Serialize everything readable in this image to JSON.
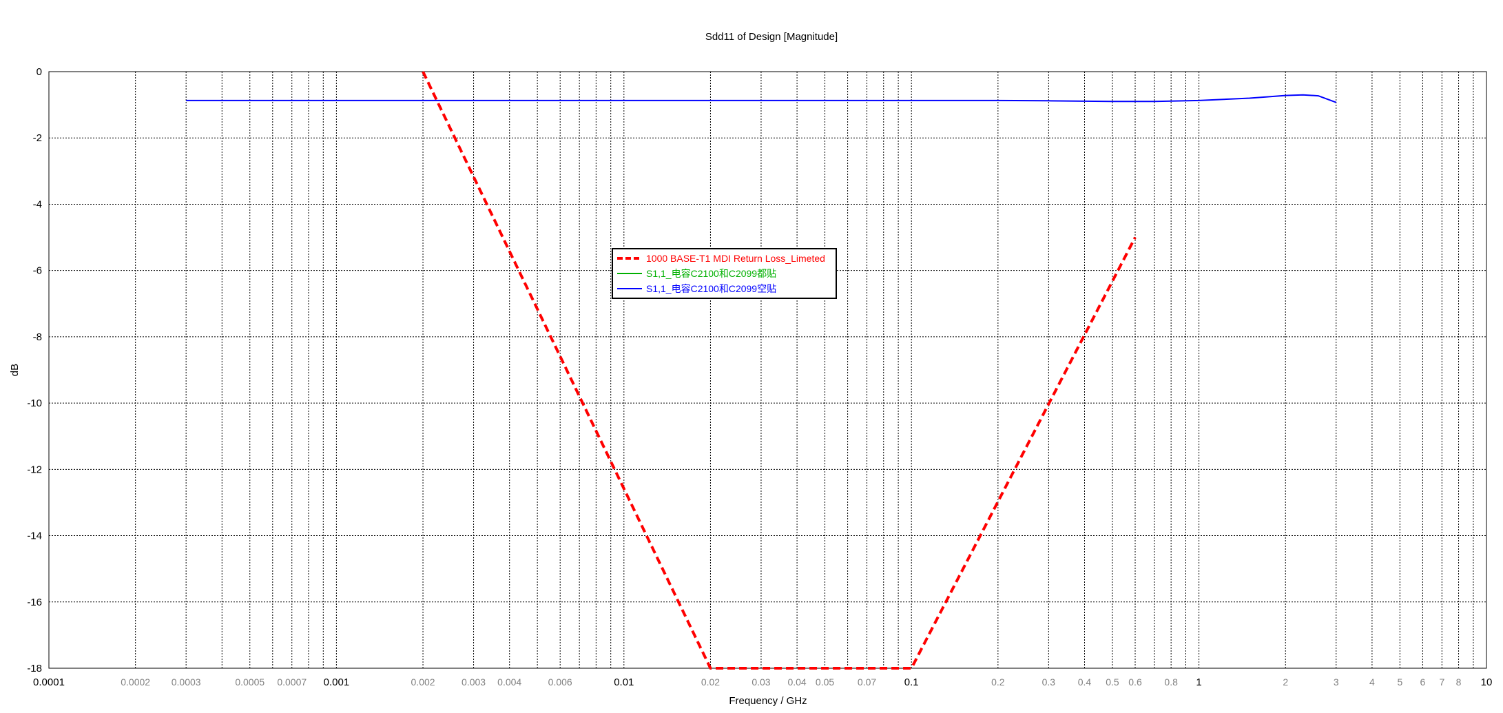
{
  "chart_data": {
    "type": "line",
    "title": "Sdd11 of Design [Magnitude]",
    "xlabel": "Frequency / GHz",
    "ylabel": "dB",
    "x_scale": "log",
    "xlim": [
      0.0001,
      10
    ],
    "ylim": [
      -18,
      0
    ],
    "grid": true,
    "legend_placement": "center",
    "x_ticks": [
      {
        "value": 0.0001,
        "label": "0.0001",
        "major": true
      },
      {
        "value": 0.0002,
        "label": "0.0002",
        "major": false
      },
      {
        "value": 0.0003,
        "label": "0.0003",
        "major": false
      },
      {
        "value": 0.0005,
        "label": "0.0005",
        "major": false
      },
      {
        "value": 0.0007,
        "label": "0.0007",
        "major": false
      },
      {
        "value": 0.001,
        "label": "0.001",
        "major": true
      },
      {
        "value": 0.002,
        "label": "0.002",
        "major": false
      },
      {
        "value": 0.003,
        "label": "0.003",
        "major": false
      },
      {
        "value": 0.004,
        "label": "0.004",
        "major": false
      },
      {
        "value": 0.006,
        "label": "0.006",
        "major": false
      },
      {
        "value": 0.01,
        "label": "0.01",
        "major": true
      },
      {
        "value": 0.02,
        "label": "0.02",
        "major": false
      },
      {
        "value": 0.03,
        "label": "0.03",
        "major": false
      },
      {
        "value": 0.04,
        "label": "0.04",
        "major": false
      },
      {
        "value": 0.05,
        "label": "0.05",
        "major": false
      },
      {
        "value": 0.07,
        "label": "0.07",
        "major": false
      },
      {
        "value": 0.1,
        "label": "0.1",
        "major": true
      },
      {
        "value": 0.2,
        "label": "0.2",
        "major": false
      },
      {
        "value": 0.3,
        "label": "0.3",
        "major": false
      },
      {
        "value": 0.4,
        "label": "0.4",
        "major": false
      },
      {
        "value": 0.5,
        "label": "0.5",
        "major": false
      },
      {
        "value": 0.6,
        "label": "0.6",
        "major": false
      },
      {
        "value": 0.8,
        "label": "0.8",
        "major": false
      },
      {
        "value": 1,
        "label": "1",
        "major": true
      },
      {
        "value": 2,
        "label": "2",
        "major": false
      },
      {
        "value": 3,
        "label": "3",
        "major": false
      },
      {
        "value": 4,
        "label": "4",
        "major": false
      },
      {
        "value": 5,
        "label": "5",
        "major": false
      },
      {
        "value": 6,
        "label": "6",
        "major": false
      },
      {
        "value": 7,
        "label": "7",
        "major": false
      },
      {
        "value": 8,
        "label": "8",
        "major": false
      },
      {
        "value": 10,
        "label": "10",
        "major": true
      }
    ],
    "y_ticks": [
      0,
      -2,
      -4,
      -6,
      -8,
      -10,
      -12,
      -14,
      -16,
      -18
    ],
    "series": [
      {
        "name": "1000 BASE-T1 MDI Return Loss_Limeted",
        "color": "#ff0000",
        "style": "dashed",
        "x": [
          0.002,
          0.02,
          0.1,
          0.6
        ],
        "y": [
          0,
          -18,
          -18,
          -5
        ]
      },
      {
        "name": "S1,1_电容C2100和C2099都贴",
        "color": "#00b000",
        "style": "solid",
        "x": [],
        "y": []
      },
      {
        "name": "S1,1_电容C2100和C2099空贴",
        "color": "#0000ff",
        "style": "solid",
        "x": [
          0.0003,
          0.001,
          0.01,
          0.1,
          0.2,
          0.3,
          0.5,
          0.7,
          1.0,
          1.5,
          2.0,
          2.3,
          2.6,
          3.0
        ],
        "y": [
          -0.87,
          -0.87,
          -0.87,
          -0.87,
          -0.87,
          -0.88,
          -0.9,
          -0.9,
          -0.87,
          -0.8,
          -0.72,
          -0.7,
          -0.73,
          -0.93
        ]
      }
    ]
  }
}
